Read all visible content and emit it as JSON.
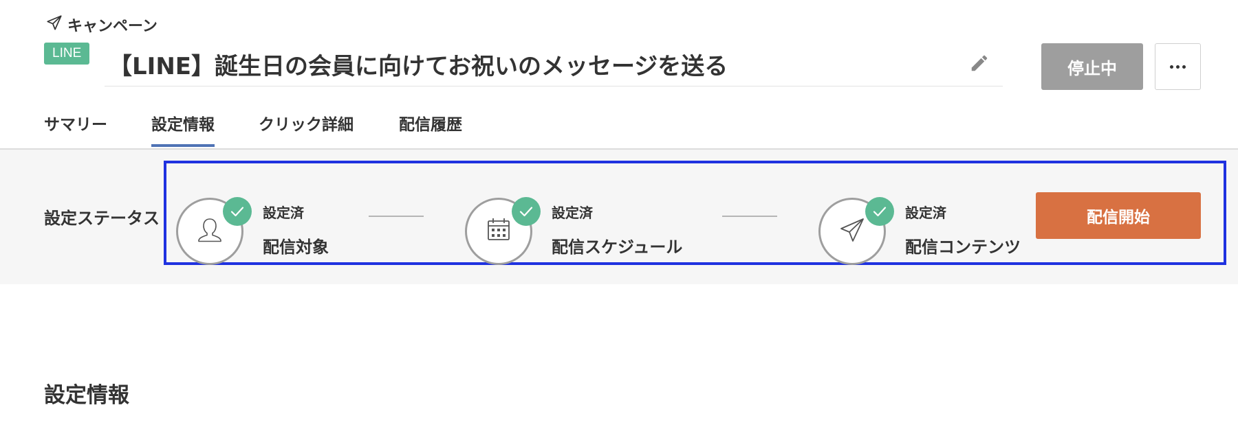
{
  "header": {
    "breadcrumb": "キャンペーン",
    "channel_badge": "LINE",
    "title": "【LINE】誕生日の会員に向けてお祝いのメッセージを送る",
    "status_button": "停止中"
  },
  "tabs": [
    {
      "label": "サマリー",
      "active": false
    },
    {
      "label": "設定情報",
      "active": true
    },
    {
      "label": "クリック詳細",
      "active": false
    },
    {
      "label": "配信履歴",
      "active": false
    }
  ],
  "setting_status": {
    "label": "設定ステータス",
    "steps": [
      {
        "state": "設定済",
        "name": "配信対象",
        "icon": "person-icon"
      },
      {
        "state": "設定済",
        "name": "配信スケジュール",
        "icon": "calendar-icon"
      },
      {
        "state": "設定済",
        "name": "配信コンテンツ",
        "icon": "paper-plane-icon"
      }
    ],
    "start_button": "配信開始"
  },
  "section": {
    "heading": "設定情報"
  },
  "colors": {
    "badge": "#5bb993",
    "check": "#5bb993",
    "tab_underline": "#4f73b5",
    "start_button": "#d87142",
    "status_button": "#9e9e9e",
    "highlight": "#1f32e0"
  }
}
